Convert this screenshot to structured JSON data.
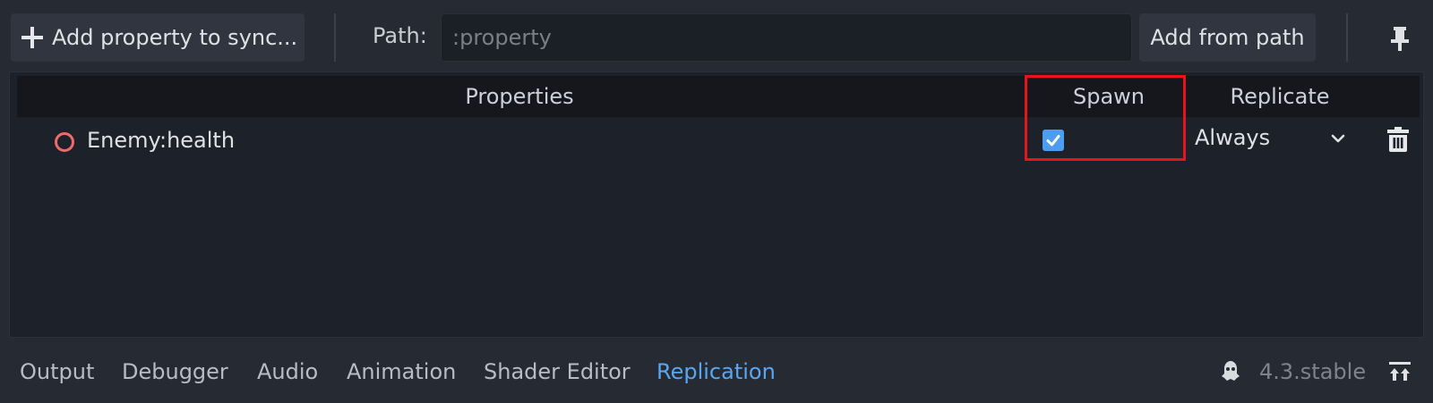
{
  "toolbar": {
    "add_property_label": "Add property to sync...",
    "path_label": "Path:",
    "path_placeholder": ":property",
    "add_from_path_label": "Add from path"
  },
  "table": {
    "columns": [
      "Properties",
      "Spawn",
      "Replicate"
    ],
    "rows": [
      {
        "property": "Enemy:health",
        "spawn": true,
        "replicate": "Always"
      }
    ]
  },
  "bottom_tabs": [
    "Output",
    "Debugger",
    "Audio",
    "Animation",
    "Shader Editor",
    "Replication"
  ],
  "active_tab": "Replication",
  "version": "4.3.stable",
  "colors": {
    "accent": "#5aa6f0",
    "checkbox": "#4d9cf0",
    "status_error": "#ee6b6b",
    "highlight": "#e8141c"
  }
}
